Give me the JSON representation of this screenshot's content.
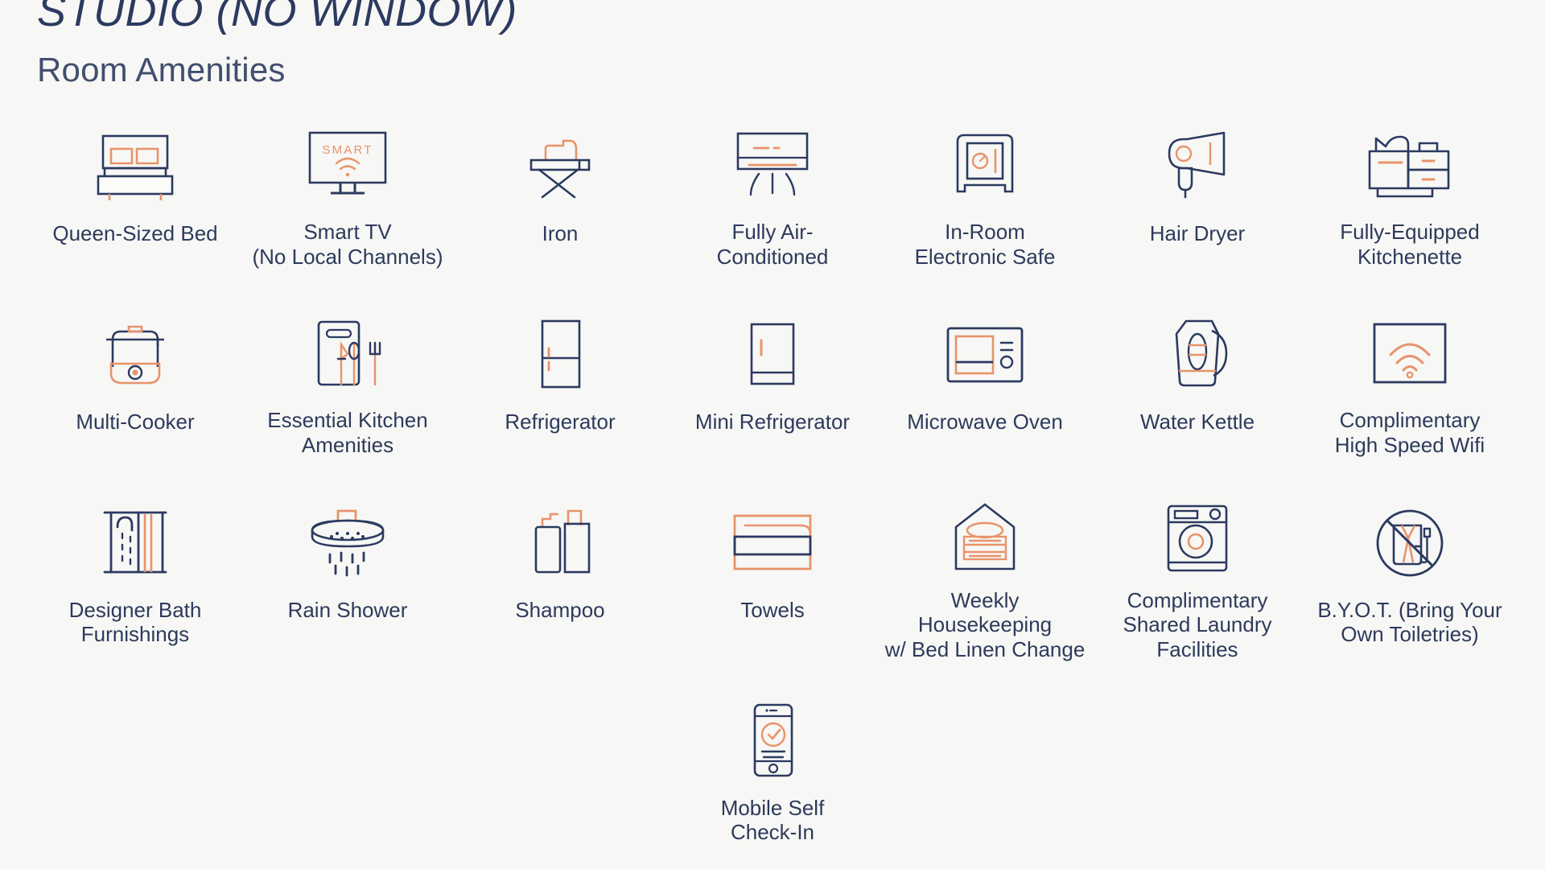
{
  "header": {
    "room_title": "STUDIO (NO WINDOW)",
    "section_title": "Room Amenities"
  },
  "colors": {
    "background": "#f7f7f5",
    "navy": "#2b3a60",
    "text_navy": "#2d3a5c",
    "accent_orange": "#e8936a",
    "accent_orange_light": "#f0b08d"
  },
  "amenities": [
    {
      "label": "Queen-Sized Bed",
      "icon": "bed-icon"
    },
    {
      "label": "Smart TV\n(No Local Channels)",
      "icon": "smart-tv-icon",
      "screen_text": "SMART"
    },
    {
      "label": "Iron",
      "icon": "iron-icon"
    },
    {
      "label": "Fully Air-\nConditioned",
      "icon": "air-conditioner-icon"
    },
    {
      "label": "In-Room\nElectronic Safe",
      "icon": "safe-icon"
    },
    {
      "label": "Hair Dryer",
      "icon": "hair-dryer-icon"
    },
    {
      "label": "Fully-Equipped\nKitchenette",
      "icon": "kitchenette-icon"
    },
    {
      "label": "Multi-Cooker",
      "icon": "multi-cooker-icon"
    },
    {
      "label": "Essential Kitchen\nAmenities",
      "icon": "kitchen-utensils-icon"
    },
    {
      "label": "Refrigerator",
      "icon": "refrigerator-icon"
    },
    {
      "label": "Mini Refrigerator",
      "icon": "mini-refrigerator-icon"
    },
    {
      "label": "Microwave Oven",
      "icon": "microwave-icon"
    },
    {
      "label": "Water Kettle",
      "icon": "kettle-icon"
    },
    {
      "label": "Complimentary\nHigh Speed Wifi",
      "icon": "wifi-icon"
    },
    {
      "label": "Designer Bath\nFurnishings",
      "icon": "bath-curtain-icon"
    },
    {
      "label": "Rain Shower",
      "icon": "rain-shower-icon"
    },
    {
      "label": "Shampoo",
      "icon": "shampoo-icon"
    },
    {
      "label": "Towels",
      "icon": "towels-icon"
    },
    {
      "label": "Weekly Housekeeping\nw/ Bed Linen Change",
      "icon": "housekeeping-icon"
    },
    {
      "label": "Complimentary\nShared Laundry\nFacilities",
      "icon": "washing-machine-icon"
    },
    {
      "label": "B.Y.O.T. (Bring Your\nOwn Toiletries)",
      "icon": "no-toiletries-icon"
    },
    {
      "label": "Mobile Self\nCheck-In",
      "icon": "mobile-checkin-icon"
    }
  ]
}
